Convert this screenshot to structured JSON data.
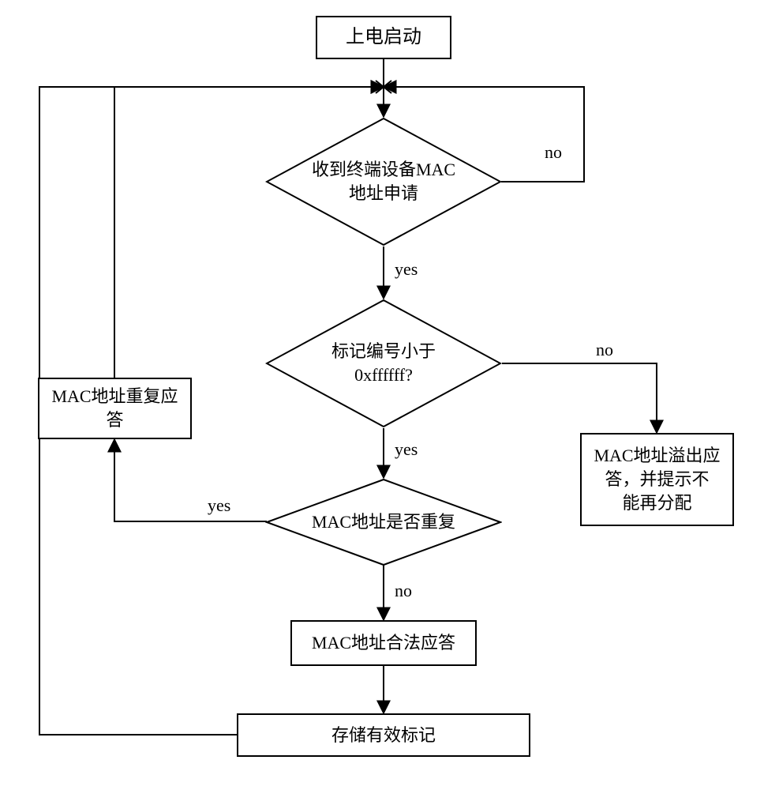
{
  "nodes": {
    "start": {
      "label": "上电启动"
    },
    "decision1": {
      "label": "收到终端设备MAC\n地址申请"
    },
    "decision2": {
      "label": "标记编号小于\n0xffffff?"
    },
    "decision3": {
      "label": "MAC地址是否重复"
    },
    "repeatResp": {
      "label": "MAC地址重复应\n答"
    },
    "overflow": {
      "label": "MAC地址溢出应\n答，并提示不\n能再分配"
    },
    "legalResp": {
      "label": "MAC地址合法应答"
    },
    "storeMark": {
      "label": "存储有效标记"
    }
  },
  "edges": {
    "yes": "yes",
    "no": "no"
  }
}
